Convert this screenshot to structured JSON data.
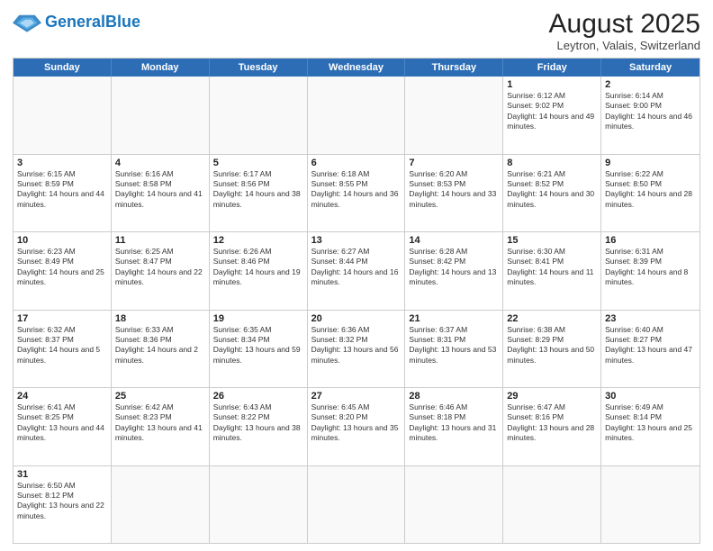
{
  "header": {
    "logo_general": "General",
    "logo_blue": "Blue",
    "main_title": "August 2025",
    "subtitle": "Leytron, Valais, Switzerland"
  },
  "weekdays": [
    "Sunday",
    "Monday",
    "Tuesday",
    "Wednesday",
    "Thursday",
    "Friday",
    "Saturday"
  ],
  "rows": [
    [
      {
        "day": "",
        "info": ""
      },
      {
        "day": "",
        "info": ""
      },
      {
        "day": "",
        "info": ""
      },
      {
        "day": "",
        "info": ""
      },
      {
        "day": "",
        "info": ""
      },
      {
        "day": "1",
        "info": "Sunrise: 6:12 AM\nSunset: 9:02 PM\nDaylight: 14 hours and 49 minutes."
      },
      {
        "day": "2",
        "info": "Sunrise: 6:14 AM\nSunset: 9:00 PM\nDaylight: 14 hours and 46 minutes."
      }
    ],
    [
      {
        "day": "3",
        "info": "Sunrise: 6:15 AM\nSunset: 8:59 PM\nDaylight: 14 hours and 44 minutes."
      },
      {
        "day": "4",
        "info": "Sunrise: 6:16 AM\nSunset: 8:58 PM\nDaylight: 14 hours and 41 minutes."
      },
      {
        "day": "5",
        "info": "Sunrise: 6:17 AM\nSunset: 8:56 PM\nDaylight: 14 hours and 38 minutes."
      },
      {
        "day": "6",
        "info": "Sunrise: 6:18 AM\nSunset: 8:55 PM\nDaylight: 14 hours and 36 minutes."
      },
      {
        "day": "7",
        "info": "Sunrise: 6:20 AM\nSunset: 8:53 PM\nDaylight: 14 hours and 33 minutes."
      },
      {
        "day": "8",
        "info": "Sunrise: 6:21 AM\nSunset: 8:52 PM\nDaylight: 14 hours and 30 minutes."
      },
      {
        "day": "9",
        "info": "Sunrise: 6:22 AM\nSunset: 8:50 PM\nDaylight: 14 hours and 28 minutes."
      }
    ],
    [
      {
        "day": "10",
        "info": "Sunrise: 6:23 AM\nSunset: 8:49 PM\nDaylight: 14 hours and 25 minutes."
      },
      {
        "day": "11",
        "info": "Sunrise: 6:25 AM\nSunset: 8:47 PM\nDaylight: 14 hours and 22 minutes."
      },
      {
        "day": "12",
        "info": "Sunrise: 6:26 AM\nSunset: 8:46 PM\nDaylight: 14 hours and 19 minutes."
      },
      {
        "day": "13",
        "info": "Sunrise: 6:27 AM\nSunset: 8:44 PM\nDaylight: 14 hours and 16 minutes."
      },
      {
        "day": "14",
        "info": "Sunrise: 6:28 AM\nSunset: 8:42 PM\nDaylight: 14 hours and 13 minutes."
      },
      {
        "day": "15",
        "info": "Sunrise: 6:30 AM\nSunset: 8:41 PM\nDaylight: 14 hours and 11 minutes."
      },
      {
        "day": "16",
        "info": "Sunrise: 6:31 AM\nSunset: 8:39 PM\nDaylight: 14 hours and 8 minutes."
      }
    ],
    [
      {
        "day": "17",
        "info": "Sunrise: 6:32 AM\nSunset: 8:37 PM\nDaylight: 14 hours and 5 minutes."
      },
      {
        "day": "18",
        "info": "Sunrise: 6:33 AM\nSunset: 8:36 PM\nDaylight: 14 hours and 2 minutes."
      },
      {
        "day": "19",
        "info": "Sunrise: 6:35 AM\nSunset: 8:34 PM\nDaylight: 13 hours and 59 minutes."
      },
      {
        "day": "20",
        "info": "Sunrise: 6:36 AM\nSunset: 8:32 PM\nDaylight: 13 hours and 56 minutes."
      },
      {
        "day": "21",
        "info": "Sunrise: 6:37 AM\nSunset: 8:31 PM\nDaylight: 13 hours and 53 minutes."
      },
      {
        "day": "22",
        "info": "Sunrise: 6:38 AM\nSunset: 8:29 PM\nDaylight: 13 hours and 50 minutes."
      },
      {
        "day": "23",
        "info": "Sunrise: 6:40 AM\nSunset: 8:27 PM\nDaylight: 13 hours and 47 minutes."
      }
    ],
    [
      {
        "day": "24",
        "info": "Sunrise: 6:41 AM\nSunset: 8:25 PM\nDaylight: 13 hours and 44 minutes."
      },
      {
        "day": "25",
        "info": "Sunrise: 6:42 AM\nSunset: 8:23 PM\nDaylight: 13 hours and 41 minutes."
      },
      {
        "day": "26",
        "info": "Sunrise: 6:43 AM\nSunset: 8:22 PM\nDaylight: 13 hours and 38 minutes."
      },
      {
        "day": "27",
        "info": "Sunrise: 6:45 AM\nSunset: 8:20 PM\nDaylight: 13 hours and 35 minutes."
      },
      {
        "day": "28",
        "info": "Sunrise: 6:46 AM\nSunset: 8:18 PM\nDaylight: 13 hours and 31 minutes."
      },
      {
        "day": "29",
        "info": "Sunrise: 6:47 AM\nSunset: 8:16 PM\nDaylight: 13 hours and 28 minutes."
      },
      {
        "day": "30",
        "info": "Sunrise: 6:49 AM\nSunset: 8:14 PM\nDaylight: 13 hours and 25 minutes."
      }
    ],
    [
      {
        "day": "31",
        "info": "Sunrise: 6:50 AM\nSunset: 8:12 PM\nDaylight: 13 hours and 22 minutes."
      },
      {
        "day": "",
        "info": ""
      },
      {
        "day": "",
        "info": ""
      },
      {
        "day": "",
        "info": ""
      },
      {
        "day": "",
        "info": ""
      },
      {
        "day": "",
        "info": ""
      },
      {
        "day": "",
        "info": ""
      }
    ]
  ],
  "colors": {
    "header_bg": "#2d6db5",
    "header_text": "#ffffff",
    "border": "#cccccc",
    "empty_bg": "#f9f9f9"
  }
}
